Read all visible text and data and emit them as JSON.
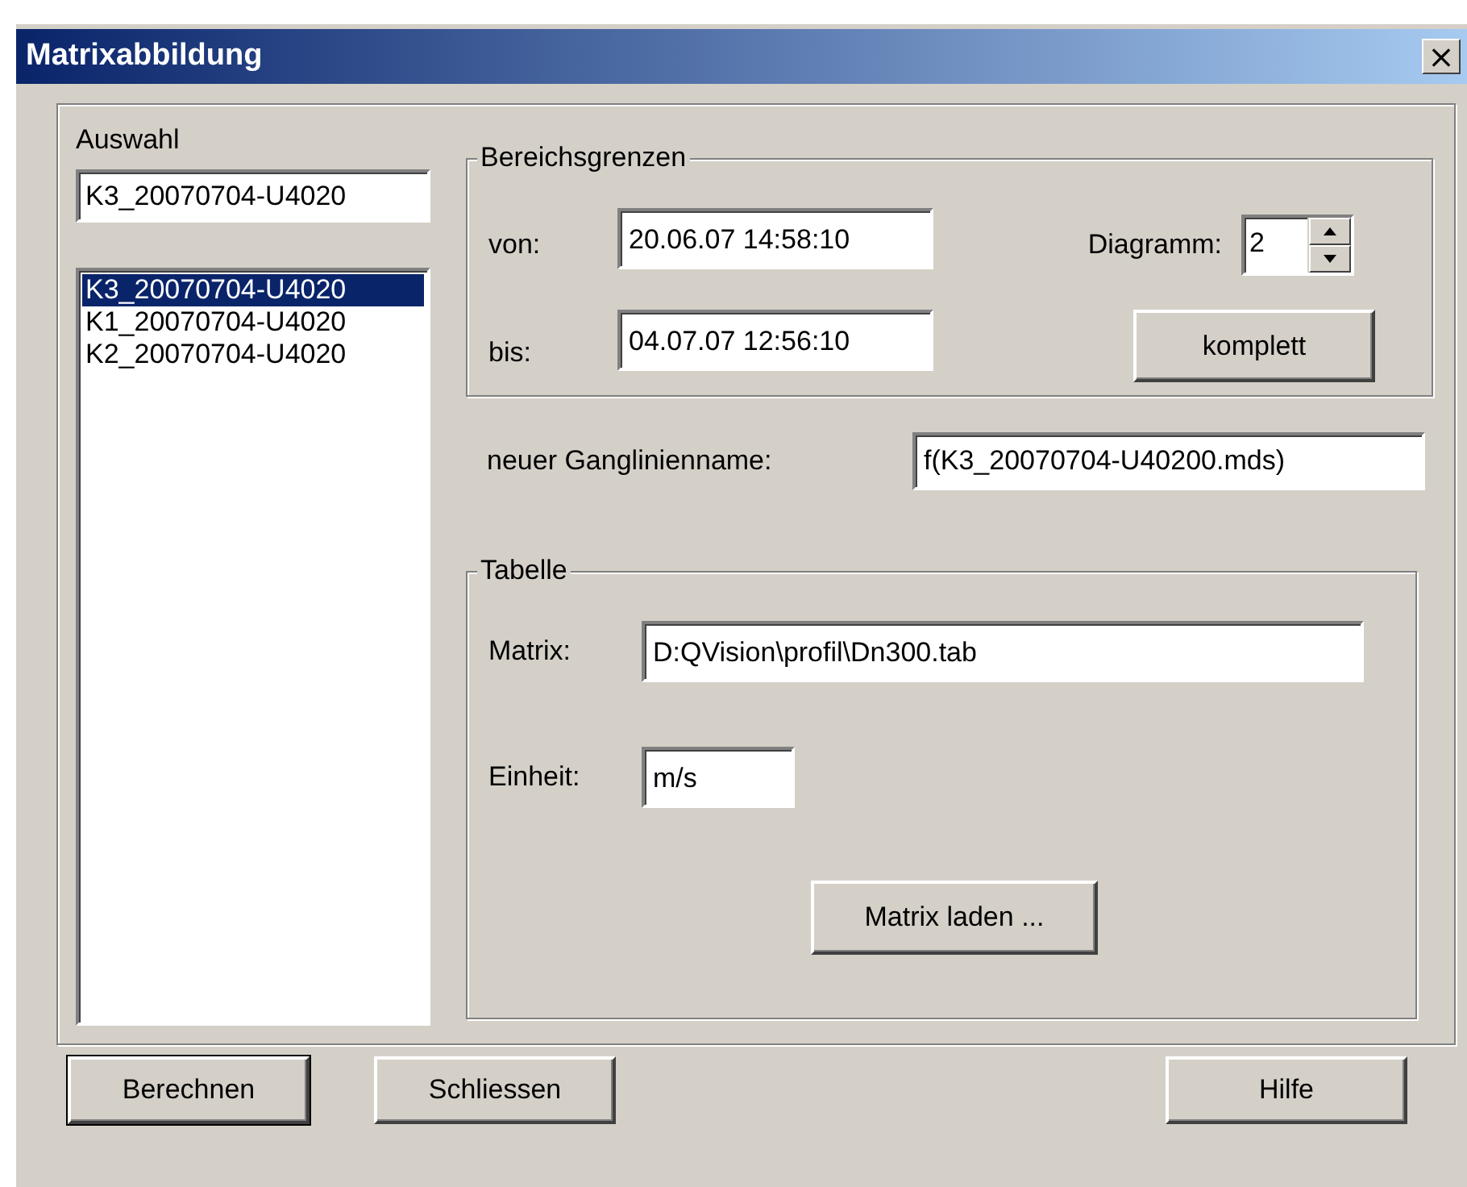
{
  "window": {
    "title": "Matrixabbildung",
    "close": "×"
  },
  "auswahl": {
    "label": "Auswahl",
    "value": "K3_20070704-U4020",
    "items": [
      {
        "label": "K3_20070704-U4020",
        "selected": true
      },
      {
        "label": "K1_20070704-U4020",
        "selected": false
      },
      {
        "label": "K2_20070704-U4020",
        "selected": false
      }
    ]
  },
  "bereichsgrenzen": {
    "title": "Bereichsgrenzen",
    "von_label": "von:",
    "von": "20.06.07 14:58:10",
    "bis_label": "bis:",
    "bis": "04.07.07 12:56:10",
    "diagramm_label": "Diagramm:",
    "diagramm": "2",
    "komplett": "komplett"
  },
  "ganglinienname": {
    "label": "neuer Ganglinienname:",
    "value": "f(K3_20070704-U40200.mds)"
  },
  "tabelle": {
    "title": "Tabelle",
    "matrix_label": "Matrix:",
    "matrix": "D:QVision\\profil\\Dn300.tab",
    "einheit_label": "Einheit:",
    "einheit": "m/s",
    "laden": "Matrix laden ..."
  },
  "buttons": [
    {
      "label": "Berechnen",
      "default": true
    },
    {
      "label": "Schliessen",
      "default": false
    },
    {
      "label": "Hilfe",
      "default": false
    }
  ]
}
